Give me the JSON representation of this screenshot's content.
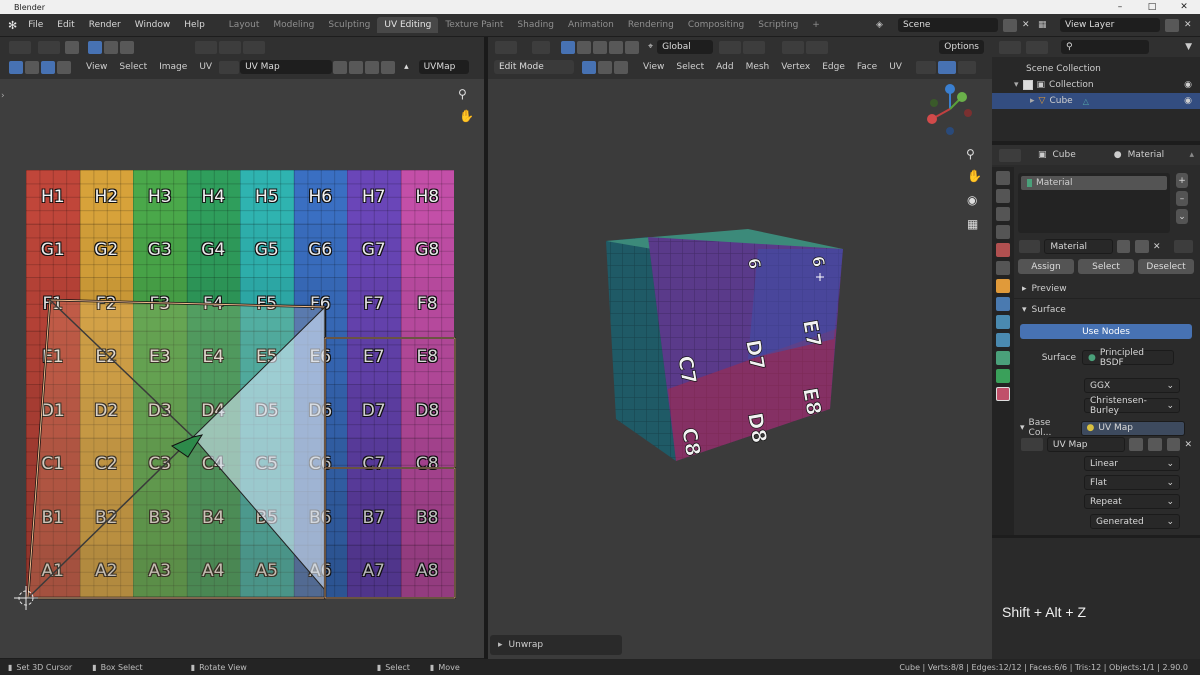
{
  "app": {
    "title": "Blender"
  },
  "menu": [
    "File",
    "Edit",
    "Render",
    "Window",
    "Help"
  ],
  "workspaces": [
    {
      "label": "Layout",
      "active": false
    },
    {
      "label": "Modeling",
      "active": false
    },
    {
      "label": "Sculpting",
      "active": false
    },
    {
      "label": "UV Editing",
      "active": true
    },
    {
      "label": "Texture Paint",
      "active": false
    },
    {
      "label": "Shading",
      "active": false
    },
    {
      "label": "Animation",
      "active": false
    },
    {
      "label": "Rendering",
      "active": false
    },
    {
      "label": "Compositing",
      "active": false
    },
    {
      "label": "Scripting",
      "active": false
    }
  ],
  "add_workspace": "+",
  "scene": {
    "value": "Scene"
  },
  "view_layer": {
    "value": "View Layer"
  },
  "uv_editor": {
    "menus": [
      "View",
      "Select",
      "Image",
      "UV"
    ],
    "uvmap_name": "UV Map",
    "uvmap_field": "UVMap"
  },
  "uv_grid": {
    "rows": [
      [
        "H1",
        "H2",
        "H3",
        "H4",
        "H5",
        "H6",
        "H7",
        "H8"
      ],
      [
        "G1",
        "G2",
        "G3",
        "G4",
        "G5",
        "G6",
        "G7",
        "G8"
      ],
      [
        "F1",
        "F2",
        "F3",
        "F4",
        "F5",
        "F6",
        "F7",
        "F8"
      ],
      [
        "E1",
        "E2",
        "E3",
        "E4",
        "E5",
        "E6",
        "E7",
        "E8"
      ],
      [
        "D1",
        "D2",
        "D3",
        "D4",
        "D5",
        "D6",
        "D7",
        "D8"
      ],
      [
        "C1",
        "C2",
        "C3",
        "C4",
        "C5",
        "C6",
        "C7",
        "C8"
      ],
      [
        "B1",
        "B2",
        "B3",
        "B4",
        "B5",
        "B6",
        "B7",
        "B8"
      ],
      [
        "A1",
        "A2",
        "A3",
        "A4",
        "A5",
        "A6",
        "A7",
        "A8"
      ]
    ],
    "column_colors": [
      "#c0463a",
      "#d7a23a",
      "#4aa84a",
      "#2f9e5c",
      "#2fb3b0",
      "#3a6fc2",
      "#6a46b8",
      "#c34fa8"
    ]
  },
  "viewport": {
    "mode": "Edit Mode",
    "orientation": "Global",
    "options": "Options",
    "menus": [
      "View",
      "Select",
      "Add",
      "Mesh",
      "Vertex",
      "Edge",
      "Face",
      "UV"
    ],
    "cube_labels": {
      "right": [
        "E7",
        "E8"
      ],
      "front": [
        "D7",
        "D8",
        "C7",
        "C8"
      ],
      "top": [
        "6",
        "6"
      ]
    },
    "operator_panel": "Unwrap"
  },
  "outliner": {
    "items": [
      {
        "label": "Scene Collection",
        "level": 0
      },
      {
        "label": "Collection",
        "level": 1
      },
      {
        "label": "Cube",
        "level": 2,
        "selected": true
      }
    ]
  },
  "properties": {
    "object": "Cube",
    "material_tab": "Material",
    "slot": "Material",
    "material_name": "Material",
    "assign": "Assign",
    "select": "Select",
    "deselect": "Deselect",
    "preview": "Preview",
    "surface_panel": "Surface",
    "use_nodes": "Use Nodes",
    "surface_label": "Surface",
    "surface_value": "Principled BSDF",
    "distribution": "GGX",
    "subsurface": "Christensen-Burley",
    "base_color_label": "Base Col...",
    "base_color_value": "UV Map",
    "image_name": "UV Map",
    "interpolation": "Linear",
    "projection": "Flat",
    "extension": "Repeat",
    "source": "Generated"
  },
  "shortcut_overlay": "Shift + Alt + Z",
  "statusbar": {
    "left": [
      {
        "label": "Set 3D Cursor"
      },
      {
        "label": "Box Select"
      },
      {
        "label": "Rotate View"
      },
      {
        "label": "Select"
      },
      {
        "label": "Move"
      }
    ],
    "right": "Cube | Verts:8/8 | Edges:12/12 | Faces:6/6 | Tris:12 | Objects:1/1 | 2.90.0"
  }
}
